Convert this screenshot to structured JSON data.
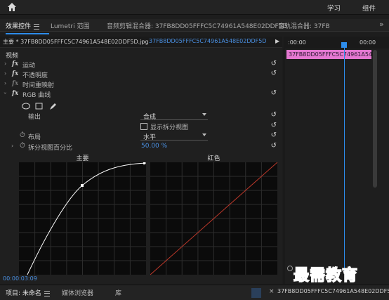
{
  "topbar": {
    "learn": "学习",
    "components": "组件"
  },
  "tabs": [
    {
      "label": "效果控件"
    },
    {
      "label": "Lumetri 范围"
    },
    {
      "label": "音频剪辑混合器: 37FB8DD05FFFC5C74961A548E02DDF5D"
    },
    {
      "label": "音轨混合器: 37FB"
    }
  ],
  "tabs_more": "»",
  "clip_bar": {
    "source": "主要 * 37FB8DD05FFFC5C74961A548E02DDF5D.jpg",
    "sequence": "37FB8DD05FFFC5C74961A548E02DDF5D * 37F...",
    "play": "▶"
  },
  "sections": {
    "video": "视频"
  },
  "effects": {
    "motion": "运动",
    "opacity": "不透明度",
    "time_remap": "时间重映射",
    "rgb_curves": "RGB 曲线"
  },
  "rgb": {
    "output_label": "输出",
    "output_value": "合成",
    "split_view_label": "显示拆分视图",
    "split_view_checked": false,
    "layout_label": "布局",
    "layout_value": "水平",
    "split_percent_label": "拆分视图百分比",
    "split_percent_value": "50.00 %"
  },
  "curves": {
    "master_title": "主要",
    "red_title": "红色",
    "master_color": "#ffffff",
    "red_color": "#c0392b"
  },
  "timecode": "00:00:03:09",
  "timeline": {
    "start": ":00:00",
    "end": "00:00",
    "clip_label": "37FB8DD05FFFC5C74961A548E02",
    "clip_color": "#e478d1"
  },
  "bottom": {
    "project": "项目: 未命名",
    "media_browser": "媒体浏览器",
    "library": "库",
    "sequence": "37FB8DD05FFFC5C74961A548E02DDF5D"
  },
  "watermark": "最需教育",
  "accent": "#2d8ceb"
}
